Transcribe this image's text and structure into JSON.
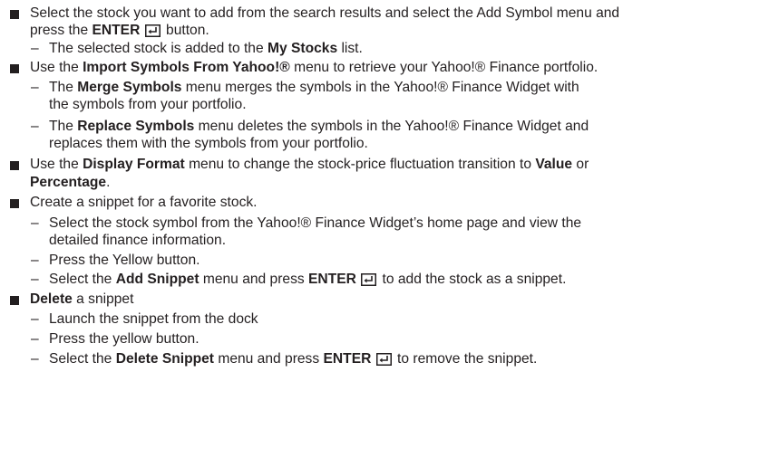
{
  "items": [
    {
      "parts": [
        "Select the stock you want to add from the search results and select the Add Symbol menu and",
        "press the ",
        "ENTER",
        " button."
      ],
      "subs": [
        {
          "pre": "The selected stock is added to the ",
          "bold": "My Stocks",
          "post": " list."
        }
      ]
    },
    {
      "pre": "Use the ",
      "bold": "Import Symbols From Yahoo!®",
      "post": " menu to retrieve your Yahoo!® Finance portfolio.",
      "subs": [
        {
          "l1_pre": "The ",
          "l1_bold": "Merge Symbols",
          "l1_post": " menu merges the symbols in the Yahoo!® Finance Widget with",
          "l2": "the symbols from your portfolio."
        },
        {
          "l1_pre": "The ",
          "l1_bold": "Replace Symbols",
          "l1_post": " menu deletes the symbols in the Yahoo!® Finance Widget and",
          "l2": "replaces them with the symbols from your portfolio."
        }
      ]
    },
    {
      "l1_pre": "Use the ",
      "l1_bold": "Display Format",
      "l1_mid": " menu to change the stock-price fluctuation transition to ",
      "l1_bold2": "Value",
      "l1_post": " or",
      "l2_bold": "Percentage",
      "l2_post": "."
    },
    {
      "text": "Create a snippet for a favorite stock.",
      "subs": [
        {
          "l1": "Select the stock symbol from the Yahoo!® Finance Widget’s home page and view the",
          "l2": "detailed finance information."
        },
        {
          "l1": "Press the Yellow button."
        },
        {
          "pre": "Select the ",
          "bold": "Add Snippet",
          "mid": " menu and press ",
          "bold2": "ENTER",
          "post": " to add the stock as a snippet."
        }
      ]
    },
    {
      "bold": "Delete",
      "post": " a snippet",
      "subs": [
        {
          "l1": "Launch the snippet from the dock"
        },
        {
          "l1": "Press the yellow button."
        },
        {
          "pre": "Select the ",
          "bold": "Delete Snippet",
          "mid": " menu and press ",
          "bold2": "ENTER",
          "post": " to remove the snippet."
        }
      ]
    }
  ],
  "dash_char": "–",
  "icons": {
    "enter": "enter-key-icon"
  }
}
